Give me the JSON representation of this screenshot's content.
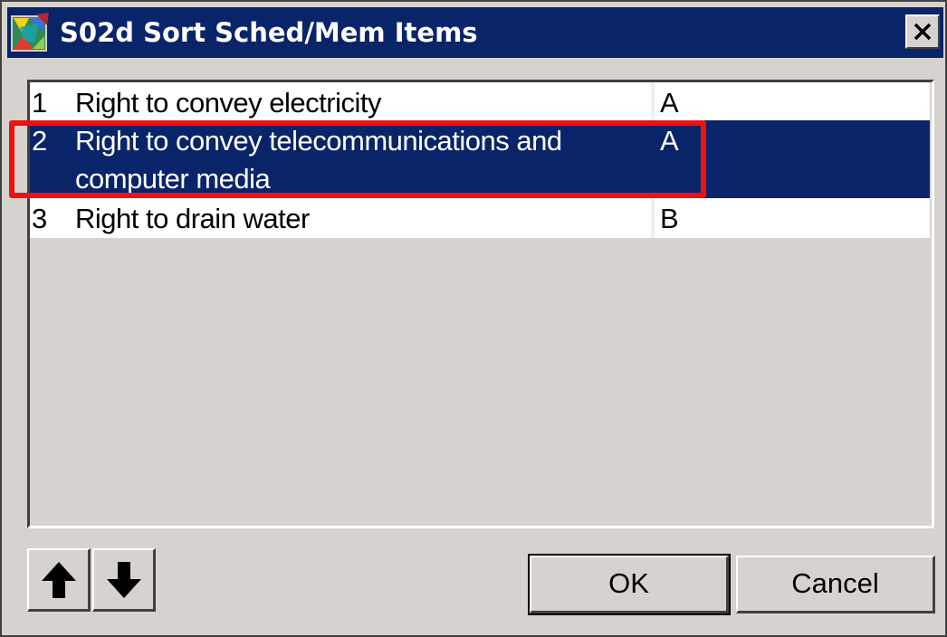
{
  "window": {
    "title": "S02d Sort Sched/Mem Items",
    "accent_color": "#0a246a",
    "title_icon": "application-icon",
    "close_icon": "close-icon"
  },
  "list": {
    "items": [
      {
        "number": "1",
        "description": "Right to convey electricity",
        "code": "A",
        "selected": false
      },
      {
        "number": "2",
        "description": "Right to convey telecommunications and computer media",
        "code": "A",
        "selected": true
      },
      {
        "number": "3",
        "description": "Right to drain water",
        "code": "B",
        "selected": false
      }
    ],
    "highlight_color": "#ee1111"
  },
  "buttons": {
    "move_up_icon": "arrow-up-icon",
    "move_down_icon": "arrow-down-icon",
    "ok_label": "OK",
    "cancel_label": "Cancel"
  }
}
